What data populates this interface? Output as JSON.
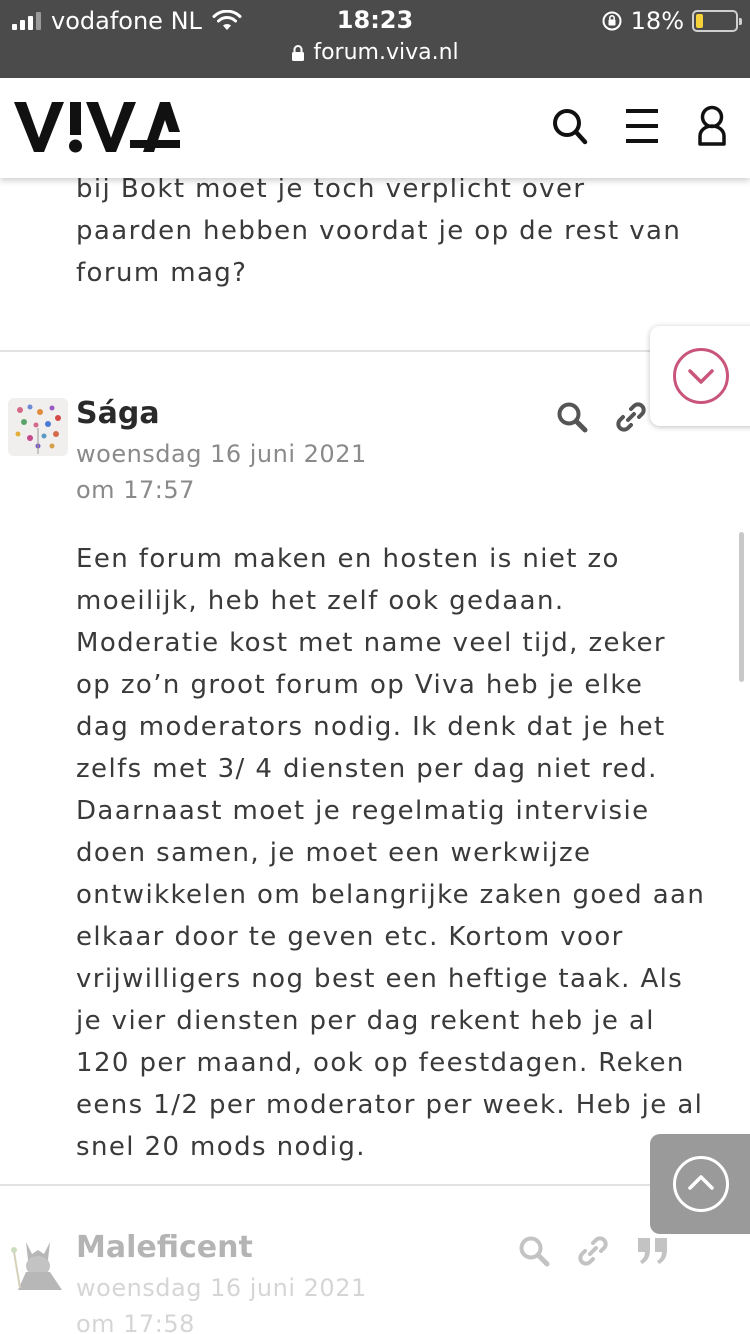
{
  "status_bar": {
    "carrier": "vodafone NL",
    "time": "18:23",
    "battery_percent": "18%",
    "battery_level": 0.18,
    "url": "forum.viva.nl"
  },
  "header": {
    "logo_text": "V!VA",
    "icons": [
      "search-icon",
      "menu-icon",
      "user-icon"
    ]
  },
  "previous_post": {
    "text_tail": "bij Bokt moet je toch verplicht over paarden hebben voordat je op de rest van forum mag?"
  },
  "posts": [
    {
      "author": "Sága",
      "date": "woensdag 16 juni 2021",
      "time": "om 17:57",
      "body": "Een forum maken en hosten is niet zo moeilijk, heb het zelf ook gedaan. Moderatie kost met name veel tijd, zeker op zo’n groot forum op Viva heb je elke dag moderators nodig. Ik denk dat je het zelfs met 3/ 4 diensten per dag niet red. Daarnaast moet je regelmatig intervisie doen samen, je moet een werkwijze ontwikkelen om belangrijke zaken goed aan elkaar door te geven etc. Kortom voor vrijwilligers nog best een heftige taak. Als je vier diensten per dag rekent heb je al 120 per maand, ook op feestdagen. Reken eens 1/2 per moderator per week. Heb je al snel 20 mods nodig.",
      "icons": [
        "search-icon",
        "link-icon"
      ]
    },
    {
      "author": "Maleficent",
      "date": "woensdag 16 juni 2021",
      "time": "om 17:58",
      "icons": [
        "search-icon",
        "link-icon",
        "quote-icon"
      ]
    }
  ],
  "colors": {
    "status_bg": "#4b4b4b",
    "accent_pink": "#c9557a",
    "text": "#3a3a3a",
    "muted": "#8a8a8a"
  }
}
